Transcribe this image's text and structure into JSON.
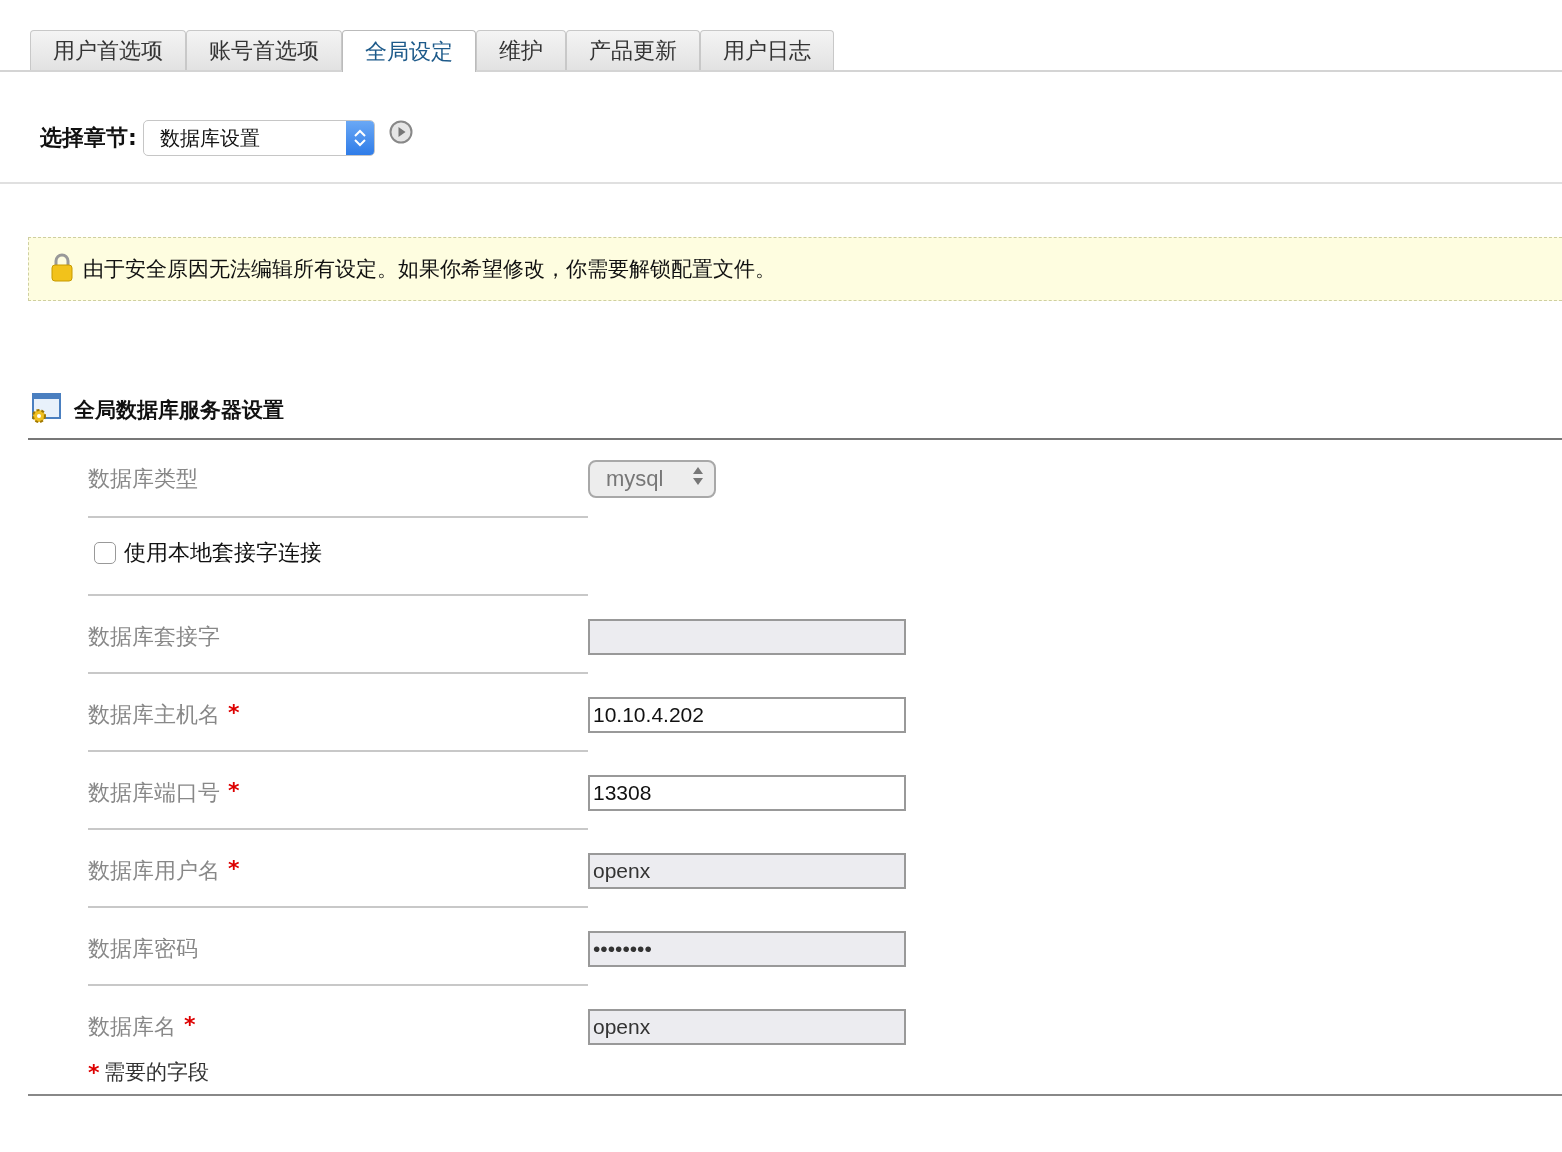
{
  "tabs": [
    {
      "label": "用户首选项",
      "selected": false
    },
    {
      "label": "账号首选项",
      "selected": false
    },
    {
      "label": "全局设定",
      "selected": true
    },
    {
      "label": "维护",
      "selected": false
    },
    {
      "label": "产品更新",
      "selected": false
    },
    {
      "label": "用户日志",
      "selected": false
    }
  ],
  "section_picker": {
    "label": "选择章节:",
    "value": "数据库设置"
  },
  "notice": {
    "text": "由于安全原因无法编辑所有设定。如果你希望修改，你需要解锁配置文件。"
  },
  "section": {
    "title": "全局数据库服务器设置",
    "fields": [
      {
        "kind": "select",
        "label": "数据库类型",
        "value": "mysql",
        "required": false,
        "disabled": true
      },
      {
        "kind": "checkbox",
        "label": "使用本地套接字连接",
        "checked": false
      },
      {
        "kind": "text",
        "label": "数据库套接字",
        "required": false,
        "disabled": true
      },
      {
        "kind": "text",
        "label": "数据库主机名",
        "value": "10.10.4.202",
        "required": true,
        "disabled": false
      },
      {
        "kind": "text",
        "label": "数据库端口号",
        "value": "13308",
        "required": true,
        "disabled": false
      },
      {
        "kind": "text",
        "label": "数据库用户名",
        "value": "openx",
        "required": true,
        "disabled": true
      },
      {
        "kind": "text",
        "label": "数据库密码",
        "value": "••••••••",
        "required": false,
        "disabled": true
      },
      {
        "kind": "text",
        "label": "数据库名",
        "value": "openx",
        "required": true,
        "disabled": true
      }
    ],
    "required_note": {
      "mark": "*",
      "text": "需要的字段"
    }
  }
}
